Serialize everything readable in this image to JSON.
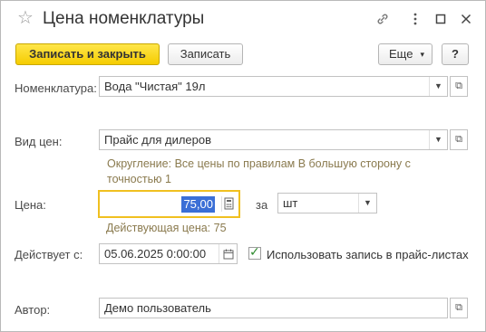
{
  "window": {
    "title": "Цена номенклатуры",
    "icons": [
      "star-icon",
      "link-icon",
      "more-vertical-icon",
      "maximize-icon",
      "close-icon"
    ]
  },
  "toolbar": {
    "save_close_label": "Записать и закрыть",
    "save_label": "Записать",
    "more_label": "Еще",
    "more_arrow": "▾",
    "help_label": "?"
  },
  "form": {
    "item": {
      "label": "Номенклатура:",
      "value": "Вода \"Чистая\" 19л"
    },
    "price_type": {
      "label": "Вид цен:",
      "value": "Прайс для дилеров",
      "rounding_line1": "Округление: Все цены по правилам В большую сторону с",
      "rounding_line2": "точностью 1"
    },
    "price": {
      "label": "Цена:",
      "value": "75,00",
      "per_label": "за",
      "unit": "шт",
      "current_price": "Действующая цена: 75"
    },
    "effective": {
      "label": "Действует с:",
      "value": "05.06.2025  0:00:00"
    },
    "use_in_pricelists": {
      "label": "Использовать запись в прайс-листах",
      "checked": true
    },
    "author": {
      "label": "Автор:",
      "value": "Демо пользователь"
    }
  },
  "colors": {
    "primary_button": "#f5cc00",
    "focus_border": "#f0c020",
    "hint_text": "#8a7a4e",
    "selection": "#3b6fd6",
    "checkmark": "#2e8b2e"
  }
}
